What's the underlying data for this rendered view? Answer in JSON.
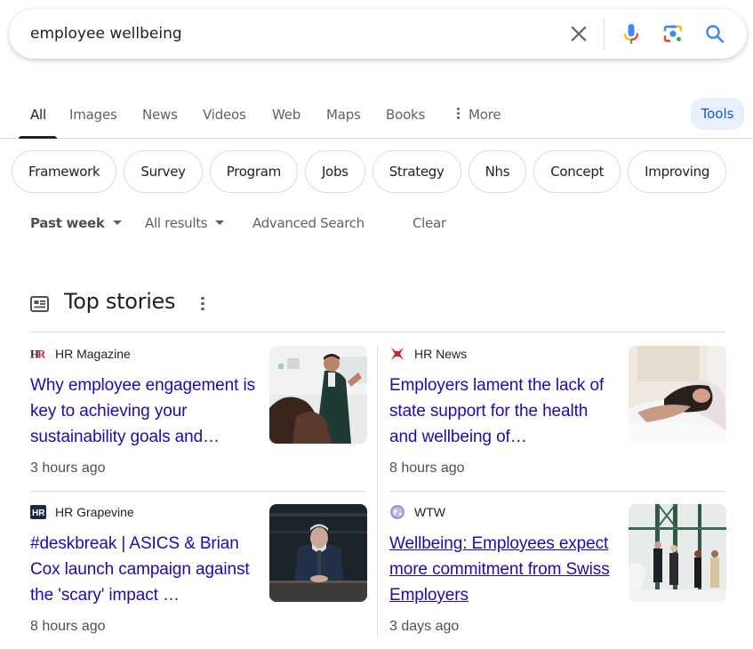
{
  "search": {
    "query": "employee wellbeing",
    "clear_icon": "close-icon",
    "voice_icon": "microphone-icon",
    "lens_icon": "camera-lens-icon",
    "search_icon": "search-icon"
  },
  "tabs": {
    "items": [
      {
        "label": "All",
        "active": true
      },
      {
        "label": "Images"
      },
      {
        "label": "News"
      },
      {
        "label": "Videos"
      },
      {
        "label": "Web"
      },
      {
        "label": "Maps"
      },
      {
        "label": "Books"
      },
      {
        "label": "More"
      }
    ],
    "tools_label": "Tools"
  },
  "chips": [
    "Framework",
    "Survey",
    "Program",
    "Jobs",
    "Strategy",
    "Nhs",
    "Concept",
    "Improving"
  ],
  "filters": {
    "time": "Past week",
    "results": "All results",
    "advanced": "Advanced Search",
    "clear": "Clear"
  },
  "top_stories": {
    "title": "Top stories",
    "stories": [
      {
        "source": "HR Magazine",
        "headline": "Why employee engagement is key to achieving your sustainability goals and…",
        "time": "3 hours ago"
      },
      {
        "source": "HR News",
        "headline": "Employers lament the lack of state support for the health and wellbeing of…",
        "time": "8 hours ago"
      },
      {
        "source": "HR Grapevine",
        "headline": "#deskbreak | ASICS & Brian Cox launch campaign against the 'scary' impact …",
        "time": "8 hours ago"
      },
      {
        "source": "WTW",
        "headline": "Wellbeing: Employees expect more commitment from Swiss Employers",
        "time": "3 days ago"
      }
    ]
  },
  "colors": {
    "link": "#1a0dab",
    "tools_bg": "#e8f0fe",
    "divider": "#dadce0"
  }
}
